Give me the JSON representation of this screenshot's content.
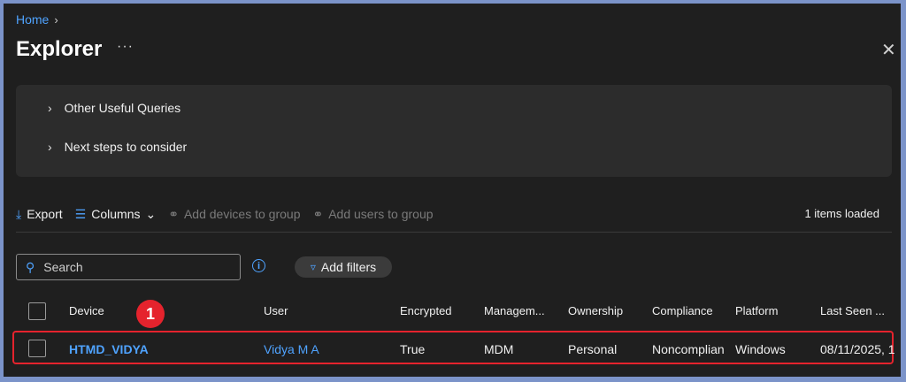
{
  "breadcrumb": {
    "home": "Home"
  },
  "header": {
    "title": "Explorer",
    "more": "···",
    "close": "✕"
  },
  "queries": [
    {
      "label": "Other Useful Queries"
    },
    {
      "label": "Next steps to consider"
    }
  ],
  "toolbar": {
    "export": "Export",
    "columns": "Columns",
    "add_devices": "Add devices to group",
    "add_users": "Add users to group",
    "status": "1 items loaded"
  },
  "search": {
    "placeholder": "Search"
  },
  "filters": {
    "add_filters": "Add filters"
  },
  "annotation": {
    "badge": "1"
  },
  "table": {
    "columns": [
      "Device",
      "User",
      "Encrypted",
      "Managem...",
      "Ownership",
      "Compliance",
      "Platform",
      "Last Seen ..."
    ],
    "rows": [
      [
        "HTMD_VIDYA",
        "Vidya M A",
        "True",
        "MDM",
        "Personal",
        "Noncomplian",
        "Windows",
        "08/11/2025, 1"
      ]
    ]
  },
  "colors": {
    "accent": "#4fa3ff",
    "highlight": "#e5232d",
    "background": "#1f1f1f"
  }
}
